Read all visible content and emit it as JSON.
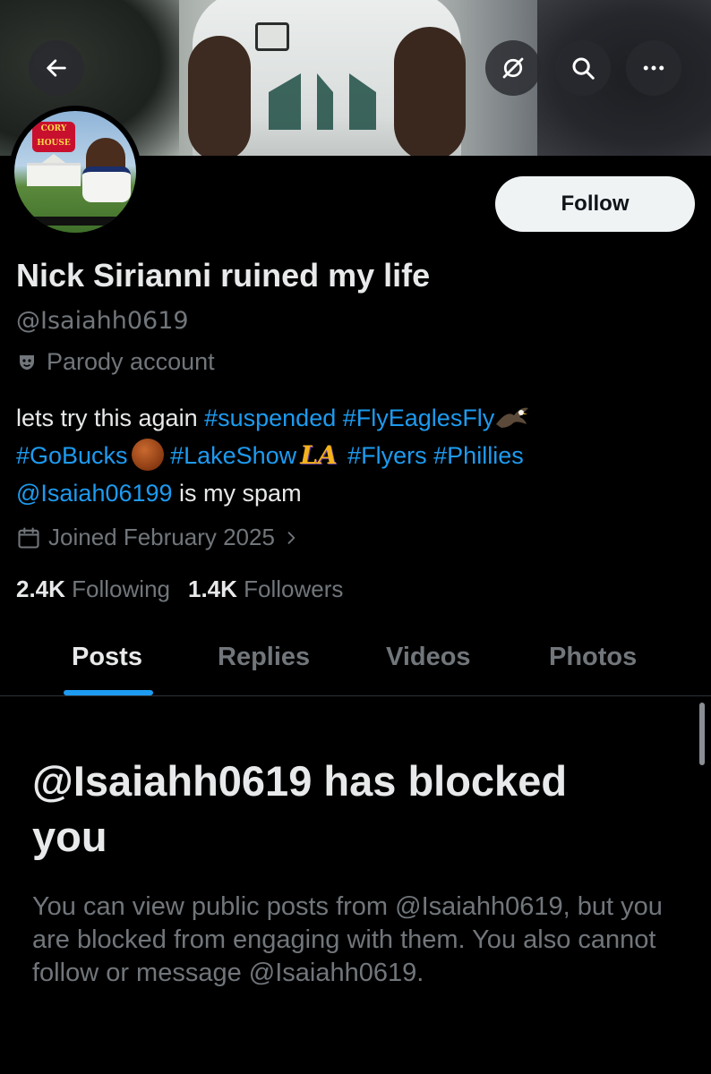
{
  "header": {
    "back_icon": "arrow-left-icon",
    "grok_icon": "grok-icon",
    "search_icon": "search-icon",
    "more_icon": "more-icon"
  },
  "profile": {
    "avatar_logo_line1": "CORY",
    "avatar_logo_line2": "HOUSE",
    "follow_label": "Follow",
    "display_name": "Nick Sirianni ruined my life",
    "handle": "@Isaiahh0619",
    "parody_label": "Parody account",
    "bio": {
      "text1": "lets try this again ",
      "tag_suspended": "#suspended",
      "tag_flyeaglesfly": "#FlyEaglesFly",
      "tag_gobucks": "#GoBucks",
      "tag_lakeshow": "#LakeShow",
      "la_emoji": "LA",
      "tag_flyers": "#Flyers",
      "tag_phillies": "#Phillies",
      "mention": "@Isaiah06199",
      "text2": " is my spam"
    },
    "joined": "Joined February 2025",
    "following_count": "2.4K",
    "following_label": "Following",
    "followers_count": "1.4K",
    "followers_label": "Followers"
  },
  "tabs": [
    {
      "label": "Posts",
      "active": true
    },
    {
      "label": "Replies",
      "active": false
    },
    {
      "label": "Videos",
      "active": false
    },
    {
      "label": "Photos",
      "active": false
    }
  ],
  "blocked": {
    "title_line1": "@Isaiahh0619 has blocked",
    "title_line2": "you",
    "message": "You can view public posts from @Isaiahh0619, but you are blocked from engaging with them. You also cannot follow or message @Isaiahh0619."
  },
  "colors": {
    "background": "#000000",
    "primary_text": "#e7e9ea",
    "secondary_text": "#71767b",
    "accent": "#1d9bf0",
    "follow_bg": "#eff3f4"
  }
}
